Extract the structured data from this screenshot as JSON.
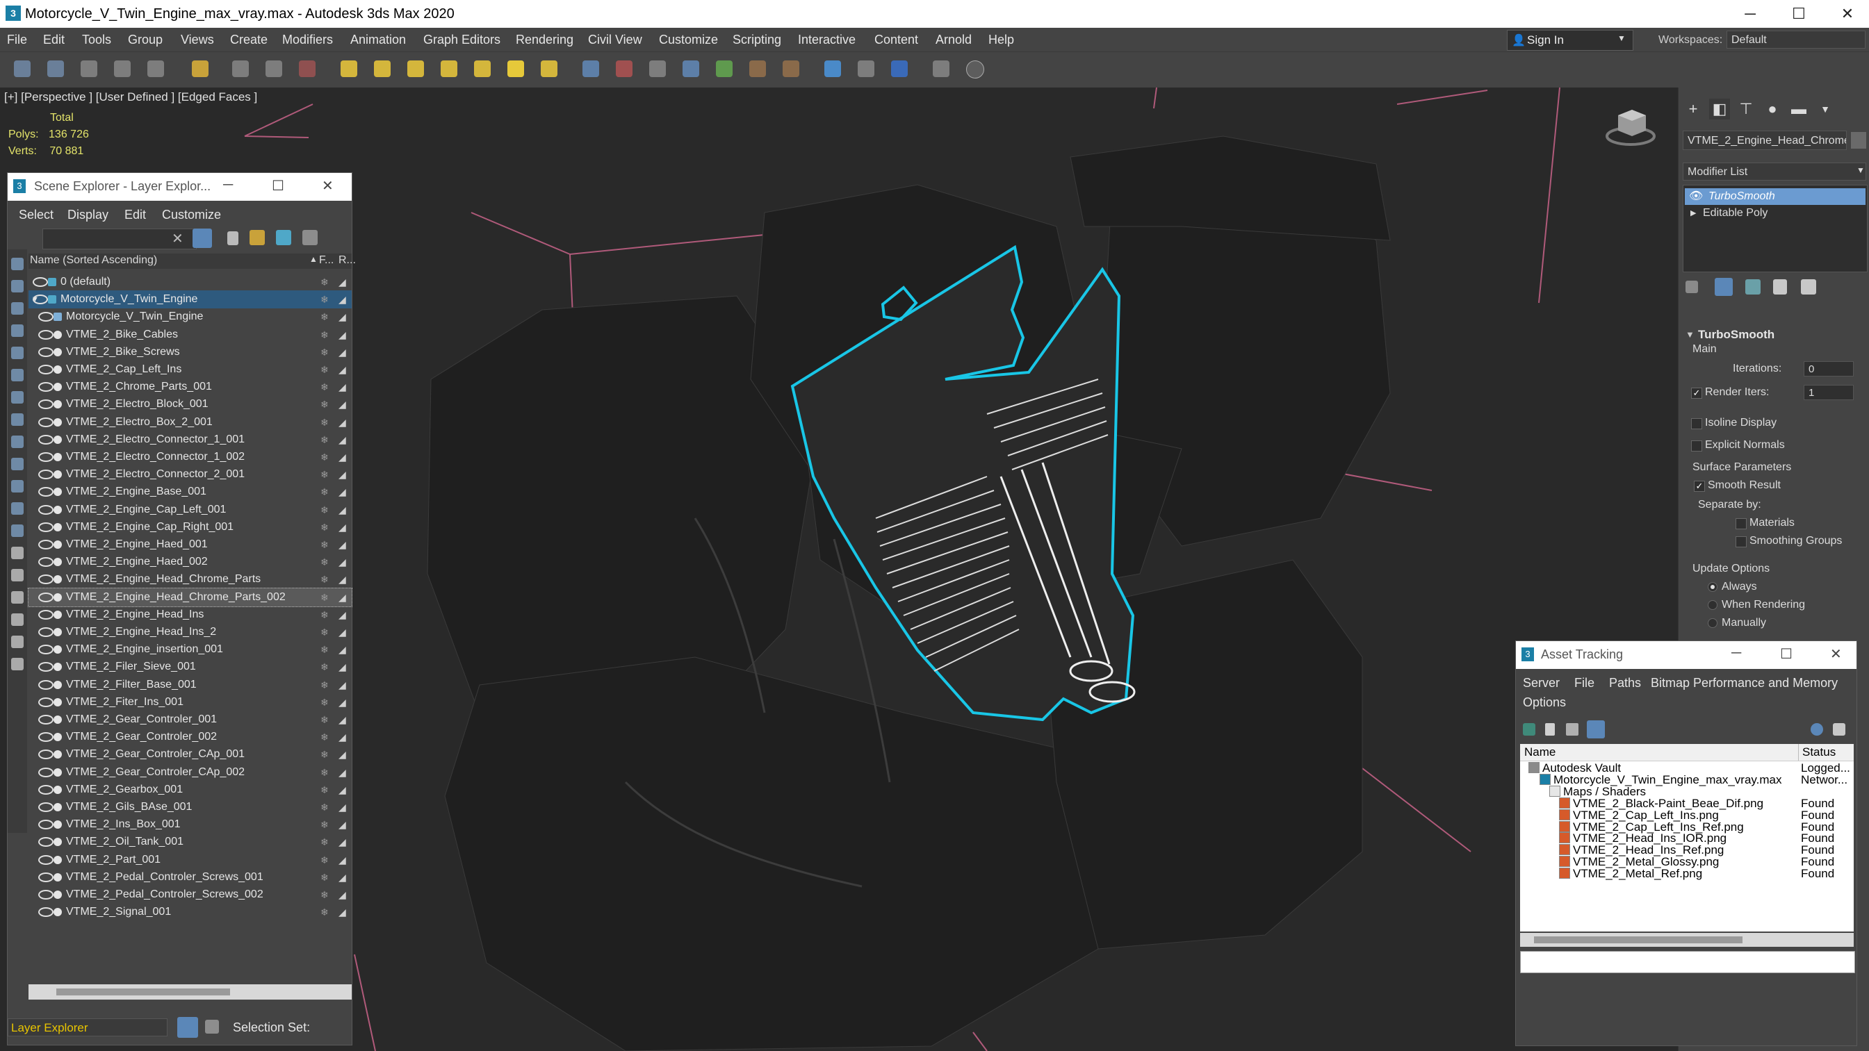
{
  "window": {
    "title": "Motorcycle_V_Twin_Engine_max_vray.max - Autodesk 3ds Max 2020",
    "app_icon": "3",
    "minimize": "─",
    "maximize": "☐",
    "close": "✕"
  },
  "menubar": {
    "items": [
      "File",
      "Edit",
      "Tools",
      "Group",
      "Views",
      "Create",
      "Modifiers",
      "Animation",
      "Graph Editors",
      "Rendering",
      "Civil View",
      "Customize",
      "Scripting",
      "Interactive",
      "Content",
      "Arnold",
      "Help"
    ],
    "sign_in": "Sign In",
    "workspaces_label": "Workspaces:",
    "workspace_value": "Default"
  },
  "viewport": {
    "label": "[+] [Perspective ] [User Defined ] [Edged Faces ]",
    "stats": {
      "total_label": "Total",
      "polys_label": "Polys:",
      "polys_value": "136 726",
      "verts_label": "Verts:",
      "verts_value": "70 881"
    },
    "selection_color": "#19c6e6",
    "grid_line_color": "#b05a7a"
  },
  "scene_explorer": {
    "title": "Scene Explorer - Layer Explor...",
    "menu": [
      "Select",
      "Display",
      "Edit",
      "Customize"
    ],
    "column_name": "Name (Sorted Ascending)",
    "column_f": "F...",
    "column_r": "R...",
    "layer_default": "0 (default)",
    "layer_engine": "Motorcycle_V_Twin_Engine",
    "objects": [
      "Motorcycle_V_Twin_Engine",
      "VTME_2_Bike_Cables",
      "VTME_2_Bike_Screws",
      "VTME_2_Cap_Left_Ins",
      "VTME_2_Chrome_Parts_001",
      "VTME_2_Electro_Block_001",
      "VTME_2_Electro_Box_2_001",
      "VTME_2_Electro_Connector_1_001",
      "VTME_2_Electro_Connector_1_002",
      "VTME_2_Electro_Connector_2_001",
      "VTME_2_Engine_Base_001",
      "VTME_2_Engine_Cap_Left_001",
      "VTME_2_Engine_Cap_Right_001",
      "VTME_2_Engine_Haed_001",
      "VTME_2_Engine_Haed_002",
      "VTME_2_Engine_Head_Chrome_Parts",
      "VTME_2_Engine_Head_Chrome_Parts_002",
      "VTME_2_Engine_Head_Ins",
      "VTME_2_Engine_Head_Ins_2",
      "VTME_2_Engine_insertion_001",
      "VTME_2_Filer_Sieve_001",
      "VTME_2_Filter_Base_001",
      "VTME_2_Fiter_Ins_001",
      "VTME_2_Gear_Controler_001",
      "VTME_2_Gear_Controler_002",
      "VTME_2_Gear_Controler_CAp_001",
      "VTME_2_Gear_Controler_CAp_002",
      "VTME_2_Gearbox_001",
      "VTME_2_Gils_BAse_001",
      "VTME_2_Ins_Box_001",
      "VTME_2_Oil_Tank_001",
      "VTME_2_Part_001",
      "VTME_2_Pedal_Controler_Screws_001",
      "VTME_2_Pedal_Controler_Screws_002",
      "VTME_2_Signal_001"
    ],
    "footer_field": "Layer Explorer",
    "selection_set_label": "Selection Set:"
  },
  "command_panel": {
    "object_name": "VTME_2_Engine_Head_Chrome",
    "modifier_list": "Modifier List",
    "stack": [
      "TurboSmooth",
      "Editable Poly"
    ],
    "rollout_title": "TurboSmooth",
    "main_label": "Main",
    "iterations_label": "Iterations:",
    "iterations_value": "0",
    "render_iters_label": "Render Iters:",
    "render_iters_value": "1",
    "isoline_display": "Isoline Display",
    "explicit_normals": "Explicit Normals",
    "surface_parameters": "Surface Parameters",
    "smooth_result": "Smooth Result",
    "separate_by": "Separate by:",
    "materials": "Materials",
    "smoothing_groups": "Smoothing Groups",
    "update_options": "Update Options",
    "always": "Always",
    "when_rendering": "When Rendering",
    "manually": "Manually"
  },
  "asset_tracking": {
    "title": "Asset Tracking",
    "menu": [
      "Server",
      "File",
      "Paths",
      "Bitmap Performance and Memory",
      "Options"
    ],
    "col_name": "Name",
    "col_status": "Status",
    "rows": [
      {
        "name": "Autodesk Vault",
        "status": "Logged..."
      },
      {
        "name": "Motorcycle_V_Twin_Engine_max_vray.max",
        "status": "Networ..."
      },
      {
        "name": "Maps / Shaders",
        "status": ""
      },
      {
        "name": "VTME_2_Black-Paint_Beae_Dif.png",
        "status": "Found"
      },
      {
        "name": "VTME_2_Cap_Left_Ins.png",
        "status": "Found"
      },
      {
        "name": "VTME_2_Cap_Left_Ins_Ref.png",
        "status": "Found"
      },
      {
        "name": "VTME_2_Head_Ins_IOR.png",
        "status": "Found"
      },
      {
        "name": "VTME_2_Head_Ins_Ref.png",
        "status": "Found"
      },
      {
        "name": "VTME_2_Metal_Glossy.png",
        "status": "Found"
      },
      {
        "name": "VTME_2_Metal_Ref.png",
        "status": "Found"
      }
    ]
  }
}
